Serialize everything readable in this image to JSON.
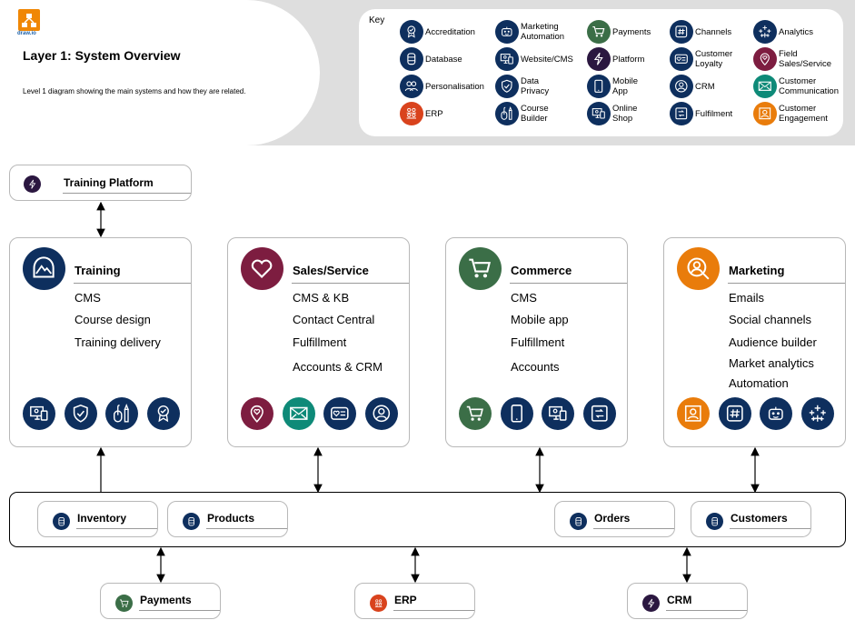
{
  "header": {
    "logo_text": "draw.io",
    "title": "Layer 1: System Overview",
    "subtitle": "Level 1 diagram showing the main systems and how they are related."
  },
  "colors": {
    "navy": "#0e2f5e",
    "green": "#3b6e47",
    "purple": "#2b1740",
    "maroon": "#7d1d40",
    "teal": "#0e8a78",
    "orange": "#e97c0b",
    "red": "#d9431d"
  },
  "key": {
    "label": "Key",
    "items": [
      {
        "label": "Accreditation",
        "icon": "accreditation-icon",
        "color": "navy"
      },
      {
        "label": "Database",
        "icon": "database-icon",
        "color": "navy"
      },
      {
        "label": "Personalisation",
        "icon": "personalisation-icon",
        "color": "navy"
      },
      {
        "label": "ERP",
        "icon": "erp-icon",
        "color": "red"
      },
      {
        "label": "Marketing\nAutomation",
        "icon": "marketing-automation-icon",
        "color": "navy"
      },
      {
        "label": "Website/CMS",
        "icon": "website-cms-icon",
        "color": "navy"
      },
      {
        "label": "Data\nPrivacy",
        "icon": "data-privacy-icon",
        "color": "navy"
      },
      {
        "label": "Course\nBuilder",
        "icon": "course-builder-icon",
        "color": "navy"
      },
      {
        "label": "Payments",
        "icon": "payments-icon",
        "color": "green"
      },
      {
        "label": "Platform",
        "icon": "platform-icon",
        "color": "purple"
      },
      {
        "label": "Mobile\nApp",
        "icon": "mobile-app-icon",
        "color": "navy"
      },
      {
        "label": "Online\nShop",
        "icon": "online-shop-icon",
        "color": "navy"
      },
      {
        "label": "Channels",
        "icon": "channels-icon",
        "color": "navy"
      },
      {
        "label": "Customer\nLoyalty",
        "icon": "customer-loyalty-icon",
        "color": "navy"
      },
      {
        "label": "CRM",
        "icon": "crm-icon",
        "color": "navy"
      },
      {
        "label": "Fulfilment",
        "icon": "fulfilment-icon",
        "color": "navy"
      },
      {
        "label": "Analytics",
        "icon": "analytics-icon",
        "color": "navy"
      },
      {
        "label": "Field\nSales/Service",
        "icon": "field-sales-icon",
        "color": "maroon"
      },
      {
        "label": "Customer\nCommunication",
        "icon": "customer-communication-icon",
        "color": "teal"
      },
      {
        "label": "Customer\nEngagement",
        "icon": "customer-engagement-icon",
        "color": "orange"
      }
    ]
  },
  "training_platform": {
    "label": "Training Platform",
    "icon": "platform-icon"
  },
  "cards": [
    {
      "title": "Training",
      "icon": "training-icon",
      "color": "navy",
      "items": [
        "CMS",
        "Course design",
        "Training delivery"
      ],
      "icons": [
        {
          "icon": "website-cms-icon",
          "color": "navy"
        },
        {
          "icon": "data-privacy-icon",
          "color": "navy"
        },
        {
          "icon": "course-builder-icon",
          "color": "navy"
        },
        {
          "icon": "accreditation-icon",
          "color": "navy"
        }
      ]
    },
    {
      "title": "Sales/Service",
      "icon": "heart-icon",
      "color": "maroon",
      "items": [
        "CMS & KB",
        "Contact Central",
        "Fulfillment",
        "Accounts & CRM"
      ],
      "icons": [
        {
          "icon": "field-sales-icon",
          "color": "maroon"
        },
        {
          "icon": "customer-communication-icon",
          "color": "teal"
        },
        {
          "icon": "customer-loyalty-icon",
          "color": "navy"
        },
        {
          "icon": "crm-icon",
          "color": "navy"
        }
      ]
    },
    {
      "title": "Commerce",
      "icon": "cart-icon",
      "color": "green",
      "items": [
        "CMS",
        "Mobile app",
        "Fulfillment",
        "Accounts"
      ],
      "icons": [
        {
          "icon": "payments-icon",
          "color": "green"
        },
        {
          "icon": "mobile-app-icon",
          "color": "navy"
        },
        {
          "icon": "online-shop-icon",
          "color": "navy"
        },
        {
          "icon": "fulfilment-icon",
          "color": "navy"
        }
      ]
    },
    {
      "title": "Marketing",
      "icon": "audience-search-icon",
      "color": "orange",
      "items": [
        "Emails",
        "Social channels",
        "Audience builder",
        "Market analytics",
        "Automation"
      ],
      "icons": [
        {
          "icon": "customer-engagement-icon",
          "color": "orange"
        },
        {
          "icon": "channels-icon",
          "color": "navy"
        },
        {
          "icon": "marketing-automation-icon",
          "color": "navy"
        },
        {
          "icon": "analytics-icon",
          "color": "navy"
        }
      ]
    }
  ],
  "data_layer": [
    {
      "label": "Inventory",
      "icon": "database-icon"
    },
    {
      "label": "Products",
      "icon": "database-icon"
    },
    {
      "label": "Orders",
      "icon": "database-icon"
    },
    {
      "label": "Customers",
      "icon": "database-icon"
    }
  ],
  "external": [
    {
      "label": "Payments",
      "icon": "payments-icon",
      "color": "green"
    },
    {
      "label": "ERP",
      "icon": "erp-icon",
      "color": "red"
    },
    {
      "label": "CRM",
      "icon": "platform-icon",
      "color": "purple"
    }
  ]
}
